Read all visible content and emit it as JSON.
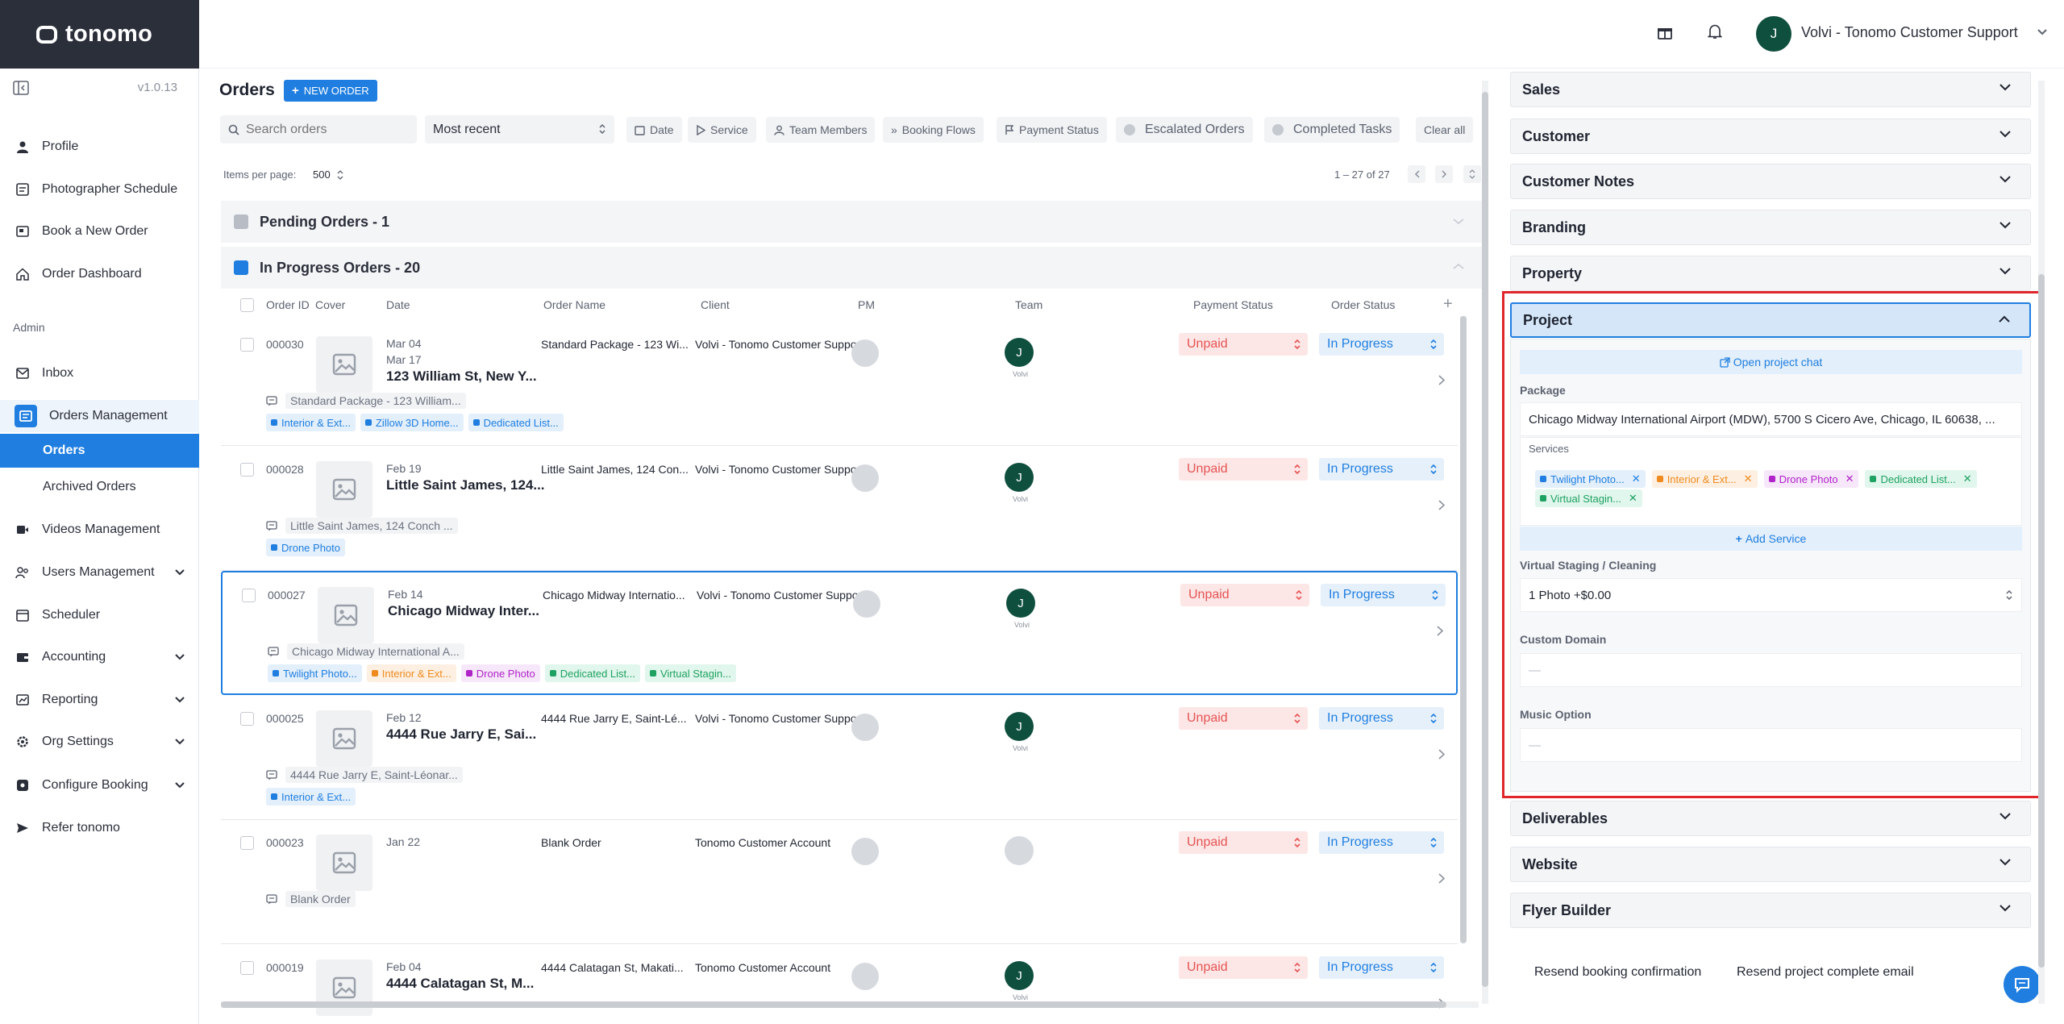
{
  "app": {
    "logo": "tonomo",
    "version": "v1.0.13"
  },
  "sidebar": {
    "items": [
      {
        "label": "Profile",
        "icon": "user-icon"
      },
      {
        "label": "Photographer Schedule",
        "icon": "schedule-icon"
      },
      {
        "label": "Book a New Order",
        "icon": "book-icon"
      },
      {
        "label": "Order Dashboard",
        "icon": "home-icon"
      }
    ],
    "admin_label": "Admin",
    "admin_items": [
      {
        "label": "Inbox",
        "icon": "inbox-icon"
      },
      {
        "label": "Orders Management",
        "icon": "orders-icon"
      },
      {
        "label": "Orders",
        "sub": true
      },
      {
        "label": "Archived Orders",
        "sub": true
      },
      {
        "label": "Videos Management",
        "icon": "video-icon"
      },
      {
        "label": "Users Management",
        "icon": "users-icon"
      },
      {
        "label": "Scheduler",
        "icon": "calendar-icon"
      },
      {
        "label": "Accounting",
        "icon": "accounting-icon"
      },
      {
        "label": "Reporting",
        "icon": "chart-icon"
      },
      {
        "label": "Org Settings",
        "icon": "gear-icon"
      },
      {
        "label": "Configure Booking",
        "icon": "configure-icon"
      },
      {
        "label": "Refer tonomo",
        "icon": "send-icon"
      }
    ]
  },
  "topbar": {
    "user_initial": "J",
    "user_name": "Volvi - Tonomo Customer Support"
  },
  "orders": {
    "title": "Orders",
    "new_order": "NEW ORDER",
    "search_placeholder": "Search orders",
    "sort": "Most recent",
    "filters": {
      "date": "Date",
      "service": "Service",
      "team": "Team Members",
      "flows": "Booking Flows",
      "payment": "Payment Status",
      "escalated": "Escalated Orders",
      "completed": "Completed Tasks",
      "clear": "Clear all"
    },
    "items_per_page_label": "Items per page:",
    "items_per_page": "500",
    "range": "1 – 27 of 27",
    "pending_header": "Pending Orders - 1",
    "inprogress_header": "In Progress Orders - 20",
    "columns": [
      "Order ID",
      "Cover",
      "Date",
      "Order Name",
      "Client",
      "PM",
      "Team",
      "Payment Status",
      "Order Status"
    ],
    "rows": [
      {
        "id": "000030",
        "date1": "Mar 04",
        "date2": "Mar 17",
        "address": "123 William St, New Y...",
        "name": "Standard Package - 123 Wi...",
        "client": "Volvi - Tonomo Customer Support",
        "team": "J",
        "team_sub": "Volvi",
        "payment": "Unpaid",
        "status": "In Progress",
        "note": "Standard Package - 123 William...",
        "tags": [
          {
            "label": "Interior & Ext...",
            "color": "blue"
          },
          {
            "label": "Zillow 3D Home...",
            "color": "blue"
          },
          {
            "label": "Dedicated List...",
            "color": "blue"
          }
        ]
      },
      {
        "id": "000028",
        "date1": "Feb 19",
        "date2": "",
        "address": "Little Saint James, 124...",
        "name": "Little Saint James, 124 Con...",
        "client": "Volvi - Tonomo Customer Support",
        "team": "J",
        "team_sub": "Volvi",
        "payment": "Unpaid",
        "status": "In Progress",
        "note": "Little Saint James, 124 Conch ...",
        "tags": [
          {
            "label": "Drone Photo",
            "color": "blue"
          }
        ]
      },
      {
        "id": "000027",
        "date1": "Feb 14",
        "date2": "",
        "address": "Chicago Midway Inter...",
        "name": "Chicago Midway Internatio...",
        "client": "Volvi - Tonomo Customer Support",
        "team": "J",
        "team_sub": "Volvi",
        "payment": "Unpaid",
        "status": "In Progress",
        "note": "Chicago Midway International A...",
        "tags": [
          {
            "label": "Twilight Photo...",
            "color": "blue"
          },
          {
            "label": "Interior & Ext...",
            "color": "orange"
          },
          {
            "label": "Drone Photo",
            "color": "purple"
          },
          {
            "label": "Dedicated List...",
            "color": "green"
          },
          {
            "label": "Virtual Stagin...",
            "color": "green"
          }
        ]
      },
      {
        "id": "000025",
        "date1": "Feb 12",
        "date2": "",
        "address": "4444 Rue Jarry E, Sai...",
        "name": "4444 Rue Jarry E, Saint-Lé...",
        "client": "Volvi - Tonomo Customer Support",
        "team": "J",
        "team_sub": "Volvi",
        "payment": "Unpaid",
        "status": "In Progress",
        "note": "4444 Rue Jarry E, Saint-Léonar...",
        "tags": [
          {
            "label": "Interior & Ext...",
            "color": "blue"
          }
        ]
      },
      {
        "id": "000023",
        "date1": "Jan 22",
        "date2": "",
        "address": "",
        "name": "Blank Order",
        "client": "Tonomo Customer Account",
        "team": "",
        "team_sub": "",
        "payment": "Unpaid",
        "status": "In Progress",
        "note": "Blank Order",
        "tags": []
      },
      {
        "id": "000019",
        "date1": "Feb 04",
        "date2": "",
        "address": "4444 Calatagan St, M...",
        "name": "4444 Calatagan St, Makati...",
        "client": "Tonomo Customer Account",
        "team": "J",
        "team_sub": "Volvi",
        "payment": "Unpaid",
        "status": "In Progress",
        "note": "",
        "tags": []
      }
    ]
  },
  "panel": {
    "sections_top": [
      "Sales",
      "Customer",
      "Customer Notes",
      "Branding",
      "Property"
    ],
    "project_title": "Project",
    "open_chat": "Open project chat",
    "package_label": "Package",
    "package_value": "Chicago Midway International Airport (MDW), 5700 S Cicero Ave, Chicago, IL 60638, ...",
    "services_label": "Services",
    "services": [
      {
        "label": "Twilight Photo...",
        "color": "blue"
      },
      {
        "label": "Interior & Ext...",
        "color": "orange"
      },
      {
        "label": "Drone Photo",
        "color": "purple"
      },
      {
        "label": "Dedicated List...",
        "color": "green"
      },
      {
        "label": "Virtual Stagin...",
        "color": "green"
      }
    ],
    "add_service": "Add Service",
    "vs_label": "Virtual Staging / Cleaning",
    "vs_value": "1 Photo +$0.00",
    "domain_label": "Custom Domain",
    "domain_value": "—",
    "music_label": "Music Option",
    "music_value": "—",
    "sections_bottom": [
      "Deliverables",
      "Website",
      "Flyer Builder"
    ],
    "resend_booking": "Resend booking confirmation",
    "resend_complete": "Resend project complete email"
  },
  "colors": {
    "accent": "#1f7ee0",
    "highlight": "#e0262b",
    "sidebar_dark": "#2b2f3a",
    "avatar": "#0f4f3e"
  }
}
